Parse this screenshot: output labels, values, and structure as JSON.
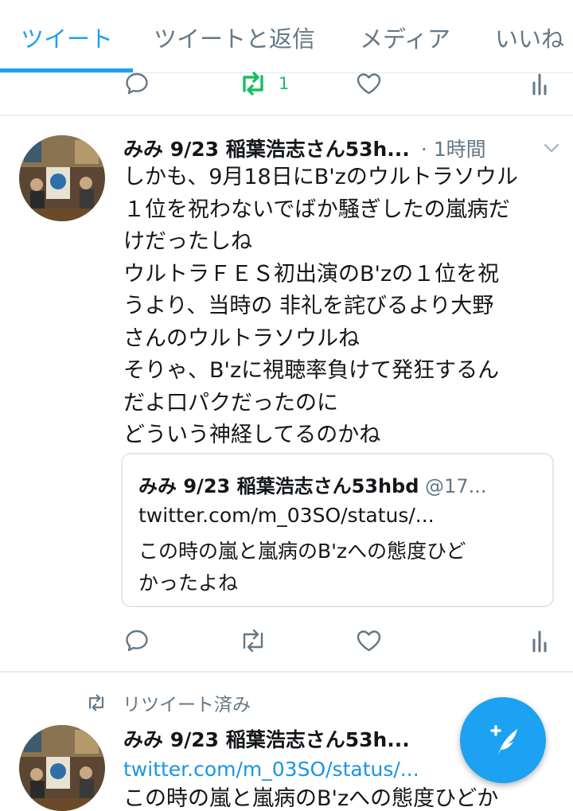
{
  "tabs": [
    "ツイート",
    "ツイートと返信",
    "メディア",
    "いいね"
  ],
  "top_actions": {
    "retweet_count": "1"
  },
  "tweet": {
    "author_name": "みみ 9/23 稲葉浩志さん53h...",
    "time": "· 1時間",
    "text_lines": [
      "しかも、9月18日にB'zのウルトラソウル",
      "１位を祝わないでばか騒ぎしたの嵐病だ",
      "けだったしね",
      "ウルトラＦＥＳ初出演のB'zの１位を祝",
      "うより、当時の 非礼を詫びるより大野",
      "さんのウルトラソウルね",
      "そりゃ、B'zに視聴率負けて発狂するん",
      "だよ口パクだったのに",
      "どういう神経してるのかね"
    ],
    "quote": {
      "author_name": "みみ 9/23 稲葉浩志さん53hbd",
      "handle": " @17...",
      "link": "twitter.com/m_03SO/status/...",
      "text_lines": [
        "この時の嵐と嵐病のB'zへの態度ひど",
        "かったよね"
      ]
    }
  },
  "retweet_label": "リツイート済み",
  "next_tweet": {
    "author_name": "みみ 9/23 稲葉浩志さん53h...",
    "link": "twitter.com/m_03SO/status/...",
    "text": "この時の嵐と嵐病のB'zへの態度ひどか"
  },
  "colors": {
    "accent": "#1da1f2",
    "retweet_active": "#17bf63",
    "muted": "#657786"
  },
  "icons": [
    "reply-icon",
    "retweet-icon",
    "like-icon",
    "analytics-icon",
    "chevron-down-icon",
    "compose-icon"
  ]
}
